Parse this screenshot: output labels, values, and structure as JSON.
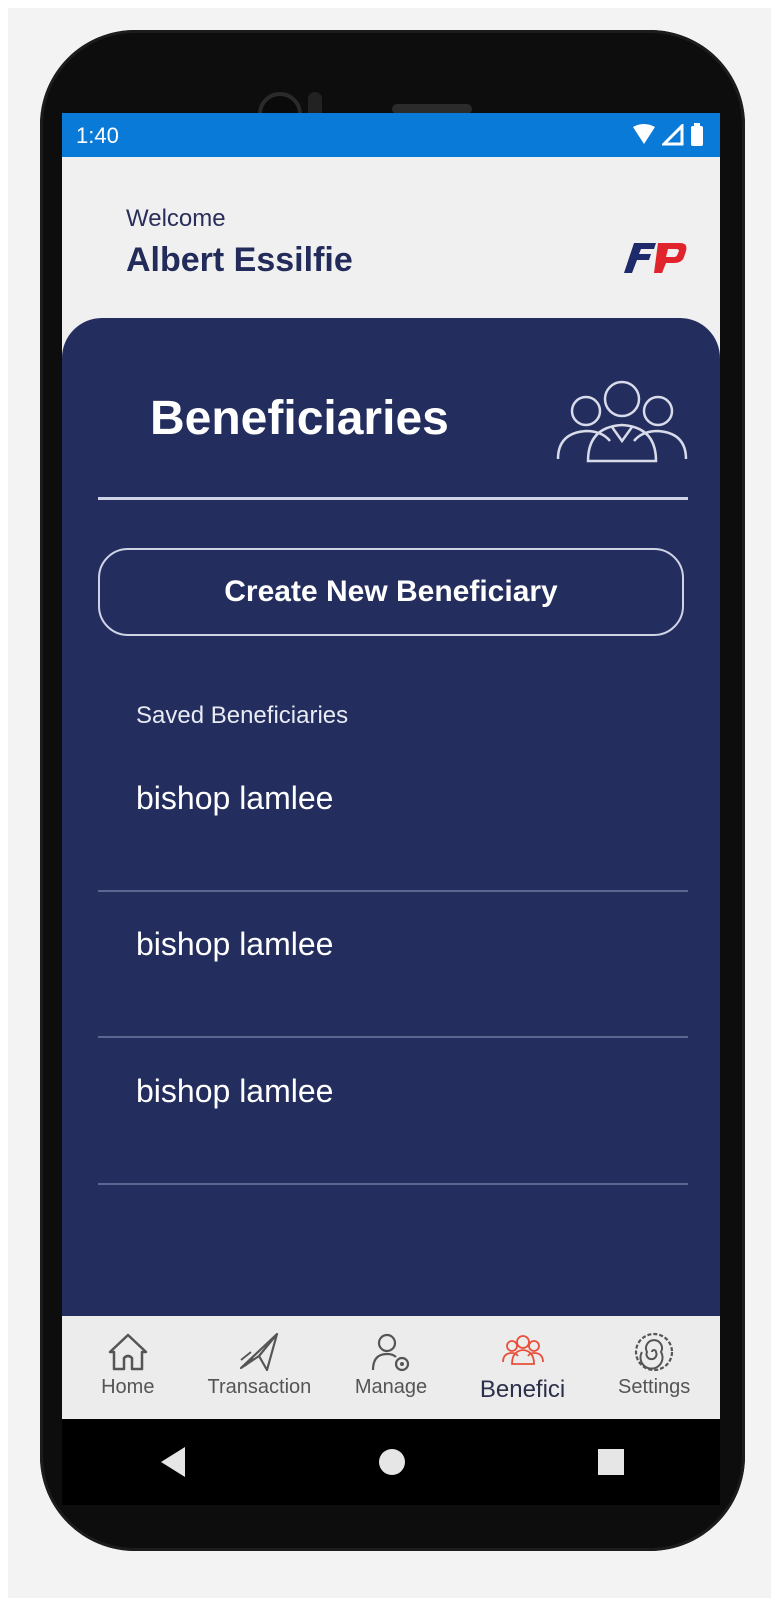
{
  "status_bar": {
    "time": "1:40"
  },
  "header": {
    "welcome": "Welcome",
    "username": "Albert Essilfie",
    "logo_text": "FP"
  },
  "page": {
    "title": "Beneficiaries"
  },
  "actions": {
    "create_label": "Create New Beneficiary"
  },
  "beneficiaries": {
    "section_label": "Saved Beneficiaries",
    "items": [
      {
        "name": "bishop lamlee"
      },
      {
        "name": "bishop lamlee"
      },
      {
        "name": "bishop lamlee"
      }
    ]
  },
  "bottom_nav": {
    "active": "Benefici",
    "items": [
      {
        "label": "Home",
        "icon": "home-icon"
      },
      {
        "label": "Transaction",
        "icon": "paper-plane-icon"
      },
      {
        "label": "Manage",
        "icon": "user-settings-icon"
      },
      {
        "label": "Benefici",
        "icon": "group-icon"
      },
      {
        "label": "Settings",
        "icon": "spiral-icon"
      }
    ]
  },
  "colors": {
    "status_bar": "#0a7ad8",
    "panel": "#242e5e",
    "accent_active": "#e8503a",
    "logo_blue": "#1f2a6b",
    "logo_red": "#e1232c"
  }
}
